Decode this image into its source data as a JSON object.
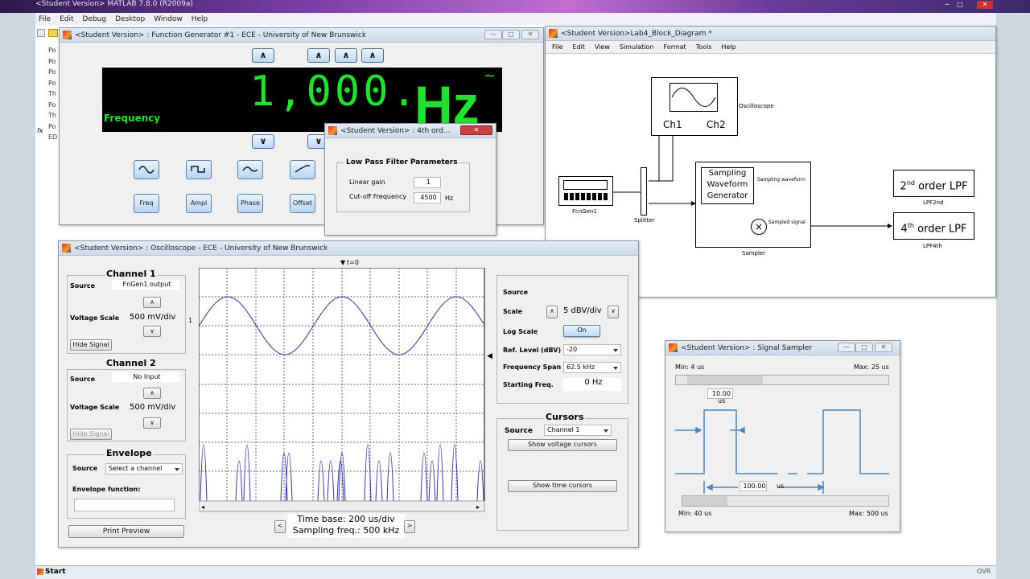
{
  "desktop": {
    "main_title": "<Student Version> MATLAB  7.8.0 (R2009a)",
    "start": "Start",
    "ovr": "OVR",
    "cmd_lines": [
      "Po",
      "Po",
      "Po",
      "Po",
      "Th",
      "Po",
      "Th",
      "Po",
      "ED"
    ],
    "fx": "fx"
  },
  "menu": [
    "File",
    "Edit",
    "Debug",
    "Desktop",
    "Window",
    "Help"
  ],
  "funcgen": {
    "title": "<Student Version> : Function Generator #1 - ECE - University of New Brunswick",
    "display": "1,000.",
    "unit": "Hz",
    "wave_symbol": "~",
    "param": "Frequency",
    "buttons": [
      "Freq",
      "Ampl",
      "Phase",
      "Offset"
    ]
  },
  "lpf": {
    "title": "<Student Version> : 4th ord...",
    "group": "Low Pass Filter Parameters",
    "gain_label": "Linear gain",
    "gain": "1",
    "cutoff_label": "Cut-off Frequency",
    "cutoff": "4500",
    "cutoff_unit": "Hz"
  },
  "block": {
    "title": "<Student Version>Lab4_Block_Diagram *",
    "menu": [
      "File",
      "Edit",
      "View",
      "Simulation",
      "Format",
      "Tools",
      "Help"
    ],
    "scope_name": "Oscilloscope",
    "ch1": "Ch1",
    "ch2": "Ch2",
    "fg_name": "FcnGen1",
    "splitter": "Splitter",
    "sampler_inner": [
      "Sampling",
      "Waveform",
      "Generator"
    ],
    "sampling_wave": "Sampling waveform",
    "sampled_sig": "Sampled signal",
    "sampler": "Sampler",
    "lpf2": "2",
    "lpf2_sup": "nd",
    "lpf2_rest": " order LPF",
    "lpf2_name": "LPF2nd",
    "lpf4": "4",
    "lpf4_sup": "th",
    "lpf4_rest": " order LPF",
    "lpf4_name": "LPF4th"
  },
  "scope": {
    "title": "<Student Version> : Oscilloscope - ECE - University of New Brunswick",
    "ch1_title": "Channel 1",
    "ch1_source_label": "Source",
    "ch1_source": "FnGen1 output",
    "vs_label": "Voltage Scale",
    "ch1_scale": "500 mV/div",
    "hide": "Hide Signal",
    "ch2_title": "Channel 2",
    "ch2_source": "No Input",
    "ch2_scale": "500 mV/div",
    "env_title": "Envelope",
    "env_source": "Select a channel",
    "env_func": "Envelope function:",
    "print": "Print Preview",
    "t0": "t=0",
    "timebase": "Time base: 200 us/div",
    "sampfreq": "Sampling freq.: 500 kHz",
    "marker1": "1",
    "r_source": "Source",
    "r_scale_label": "Scale",
    "r_scale": "5 dBV/div",
    "log_label": "Log Scale",
    "log_btn": "On",
    "ref_label": "Ref. Level (dBV)",
    "ref": "-20",
    "span_label": "Frequency Span",
    "span": "62.5 kHz",
    "start_label": "Starting Freq.",
    "start": "0 Hz",
    "cursors": "Cursors",
    "cur_source": "Channel 1",
    "show_v": "Show voltage cursors",
    "show_t": "Show time cursors",
    "prev": "<",
    "next": ">"
  },
  "sampler_win": {
    "title": "<Student Version> : Signal Sampler",
    "min_top": "Min: 4 us",
    "max_top": "Max: 25 us",
    "width_val": "10.00",
    "width_unit": "us",
    "period_val": "100.00",
    "period_unit": "us",
    "min_bot": "Min: 40 us",
    "max_bot": "Max: 500 us"
  },
  "colors": {
    "trace": "#3030a0",
    "lcd_green": "#22e030",
    "lcd_bg": "#000000"
  }
}
